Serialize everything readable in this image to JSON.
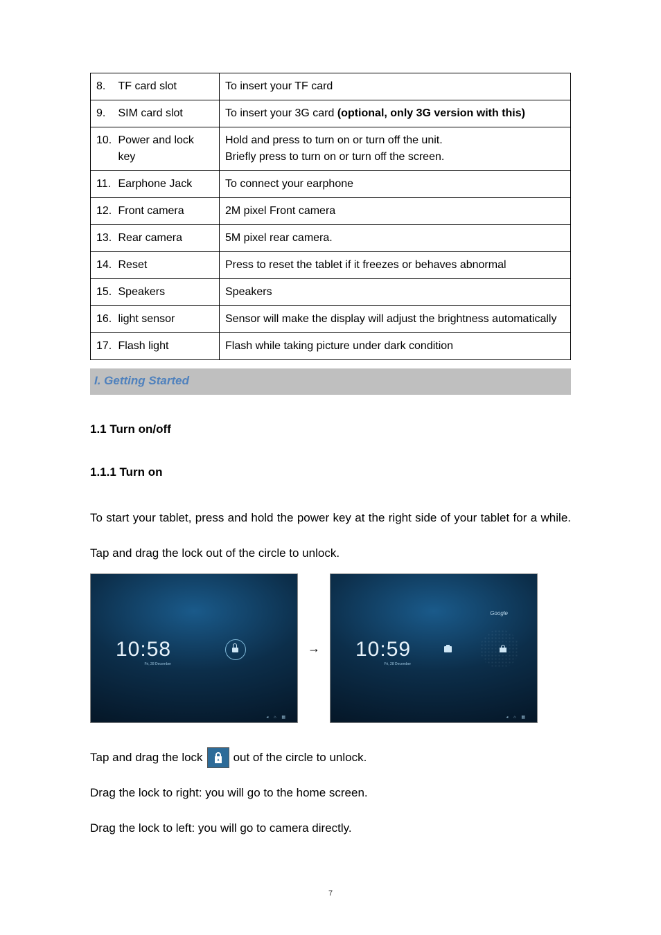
{
  "table": {
    "rows": [
      {
        "num": "8.",
        "name": "TF card slot",
        "desc": "To insert your TF card"
      },
      {
        "num": "9.",
        "name": "SIM card slot",
        "desc_pre": "To insert your 3G card ",
        "desc_bold": "(optional, only 3G version with this)"
      },
      {
        "num": "10.",
        "name": "Power and lock key",
        "desc": "Hold and press to turn on or turn off the unit.\nBriefly press to turn on or turn off the screen."
      },
      {
        "num": "11.",
        "name": "Earphone Jack",
        "desc": "To connect your earphone"
      },
      {
        "num": "12.",
        "name": "Front camera",
        "desc": "2M pixel Front camera"
      },
      {
        "num": "13.",
        "name": "Rear camera",
        "desc": "5M pixel rear camera."
      },
      {
        "num": "14.",
        "name": "Reset",
        "desc": "Press to reset the tablet if it freezes or behaves abnormal"
      },
      {
        "num": "15.",
        "name": "Speakers",
        "desc": "Speakers"
      },
      {
        "num": "16.",
        "name": "light sensor",
        "desc": "Sensor will make the display will adjust the brightness automatically"
      },
      {
        "num": "17.",
        "name": "Flash light",
        "desc": "Flash while taking picture under dark condition"
      }
    ]
  },
  "section_title": "I. Getting Started",
  "h_1_1": "1.1 Turn on/off",
  "h_1_1_1": "1.1.1 Turn on",
  "para_intro": "To start your tablet, press and hold the power key at the right side of your tablet for a while. Tap and drag the lock out of the circle to unlock.",
  "arrow": "→",
  "shot1": {
    "time": "10:58",
    "date": "Fri, 28 December"
  },
  "shot2": {
    "time": "10:59",
    "date": "Fri, 28 December",
    "google": "Google"
  },
  "after_pre": "Tap and drag the lock",
  "after_post": "out of the circle to unlock.",
  "line_right": "Drag the lock to right: you will go to the home screen.",
  "line_left": "Drag the lock to left: you will go to camera directly.",
  "page_number": "7"
}
